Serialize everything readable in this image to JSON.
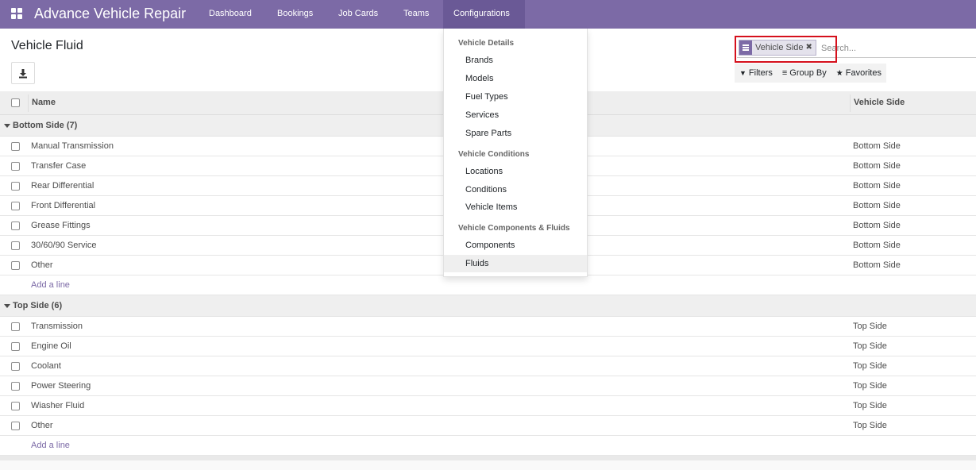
{
  "navbar": {
    "brand": "Advance Vehicle Repair",
    "menu": [
      {
        "label": "Dashboard"
      },
      {
        "label": "Bookings"
      },
      {
        "label": "Job Cards"
      },
      {
        "label": "Teams"
      },
      {
        "label": "Configurations"
      }
    ],
    "active_menu": "Configurations"
  },
  "control_panel": {
    "title": "Vehicle Fluid",
    "search": {
      "facet_label": "Vehicle Side",
      "facet_remove": "✖",
      "placeholder": "Search..."
    },
    "filters_label": "Filters",
    "group_by_label": "Group By",
    "favorites_label": "Favorites"
  },
  "list": {
    "columns": {
      "name": "Name",
      "side": "Vehicle Side"
    },
    "groups": [
      {
        "label": "Bottom Side (7)",
        "rows": [
          {
            "name": "Manual Transmission",
            "side": "Bottom Side"
          },
          {
            "name": "Transfer Case",
            "side": "Bottom Side"
          },
          {
            "name": "Rear Differential",
            "side": "Bottom Side"
          },
          {
            "name": "Front Differential",
            "side": "Bottom Side"
          },
          {
            "name": "Grease Fittings",
            "side": "Bottom Side"
          },
          {
            "name": "30/60/90 Service",
            "side": "Bottom Side"
          },
          {
            "name": "Other",
            "side": "Bottom Side"
          }
        ],
        "add_line": "Add a line"
      },
      {
        "label": "Top Side (6)",
        "rows": [
          {
            "name": "Transmission",
            "side": "Top Side"
          },
          {
            "name": "Engine Oil",
            "side": "Top Side"
          },
          {
            "name": "Coolant",
            "side": "Top Side"
          },
          {
            "name": "Power Steering",
            "side": "Top Side"
          },
          {
            "name": "Wiasher Fluid",
            "side": "Top Side"
          },
          {
            "name": "Other",
            "side": "Top Side"
          }
        ],
        "add_line": "Add a line"
      }
    ]
  },
  "dropdown": {
    "sections": [
      {
        "header": "Vehicle Details",
        "items": [
          "Brands",
          "Models",
          "Fuel Types",
          "Services",
          "Spare Parts"
        ]
      },
      {
        "header": "Vehicle Conditions",
        "items": [
          "Locations",
          "Conditions",
          "Vehicle Items"
        ]
      },
      {
        "header": "Vehicle Components & Fluids",
        "items": [
          "Components",
          "Fluids"
        ]
      }
    ],
    "active_item": "Fluids"
  },
  "colors": {
    "navbar": "#7c6aa6",
    "navbar_active": "#6a5996",
    "highlight_box": "#d5101c",
    "link": "#7c6aa6"
  }
}
